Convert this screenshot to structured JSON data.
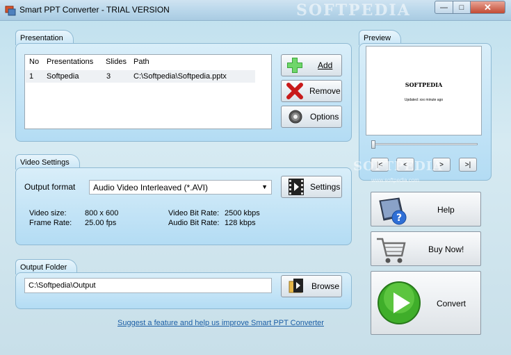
{
  "window": {
    "title": "Smart PPT Converter - TRIAL VERSION",
    "watermark": "SOFTPEDIA"
  },
  "presentation": {
    "section_title": "Presentation",
    "columns": [
      "No",
      "Presentations",
      "Slides",
      "Path"
    ],
    "rows": [
      {
        "no": "1",
        "name": "Softpedia",
        "slides": "3",
        "path": "C:\\Softpedia\\Softpedia.pptx"
      }
    ],
    "add_label": "Add",
    "remove_label": "Remove",
    "options_label": "Options"
  },
  "preview": {
    "section_title": "Preview",
    "slide_title": "SOFTPEDIA",
    "slide_subtitle": "Updated: xxx minute ago",
    "nav": {
      "first": "|<",
      "prev": "<",
      "next": ">",
      "last": ">|"
    },
    "watermark": "SOFTPEDIA",
    "watermark_url": "www.softpedia.com"
  },
  "video": {
    "section_title": "Video Settings",
    "output_format_label": "Output format",
    "output_format_value": "Audio Video Interleaved (*.AVI)",
    "settings_label": "Settings",
    "video_size_label": "Video size:",
    "video_size": "800 x 600",
    "frame_rate_label": "Frame Rate:",
    "frame_rate": "25.00 fps",
    "video_bitrate_label": "Video Bit Rate:",
    "video_bitrate": "2500 kbps",
    "audio_bitrate_label": "Audio Bit Rate:",
    "audio_bitrate": "128 kbps"
  },
  "output": {
    "section_title": "Output Folder",
    "path": "C:\\Softpedia\\Output",
    "browse_label": "Browse"
  },
  "side": {
    "help_label": "Help",
    "buy_label": "Buy Now!",
    "convert_label": "Convert"
  },
  "footer_link": "Suggest a feature and help us improve Smart PPT Converter"
}
